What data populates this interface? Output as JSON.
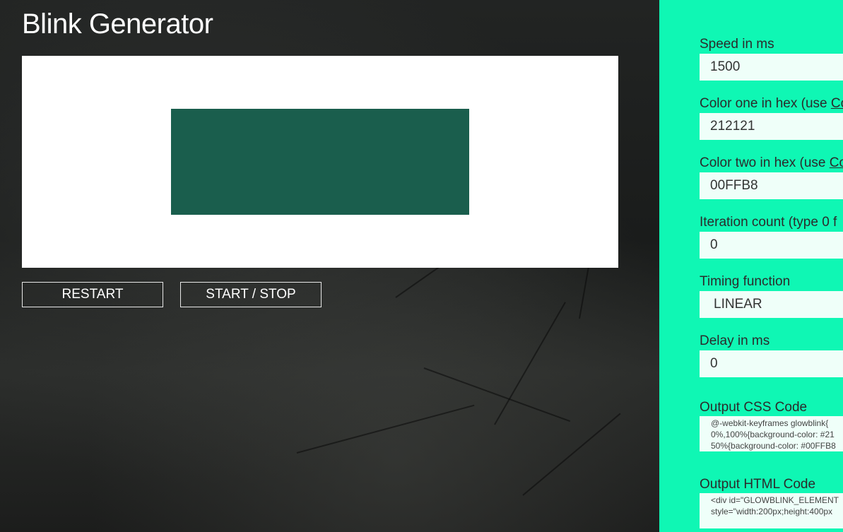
{
  "header": {
    "title": "Blink Generator"
  },
  "preview": {
    "element_color": "#1a5e4d",
    "background": "#ffffff"
  },
  "buttons": {
    "restart": "RESTART",
    "start_stop": "START / STOP"
  },
  "settings": {
    "accent": "#0ff7b4",
    "speed": {
      "label": "Speed in ms",
      "value": "1500"
    },
    "color_one": {
      "label": "Color one in hex (use ",
      "link": "Co",
      "value": "212121"
    },
    "color_two": {
      "label": "Color two in hex (use ",
      "link": "Co",
      "value": "00FFB8"
    },
    "iteration": {
      "label": "Iteration count (type 0 f",
      "value": "0"
    },
    "timing": {
      "label": "Timing function",
      "value": "LINEAR"
    },
    "delay": {
      "label": "Delay in ms",
      "value": "0"
    },
    "css_output": {
      "label": "Output CSS Code",
      "lines": [
        "@-webkit-keyframes glowblink{",
        "0%,100%{background-color: #21",
        "50%{background-color: #00FFB8"
      ]
    },
    "html_output": {
      "label": "Output HTML Code",
      "lines": [
        "<div id=\"GLOWBLINK_ELEMENT",
        "style=\"width:200px;height:400px"
      ]
    }
  }
}
